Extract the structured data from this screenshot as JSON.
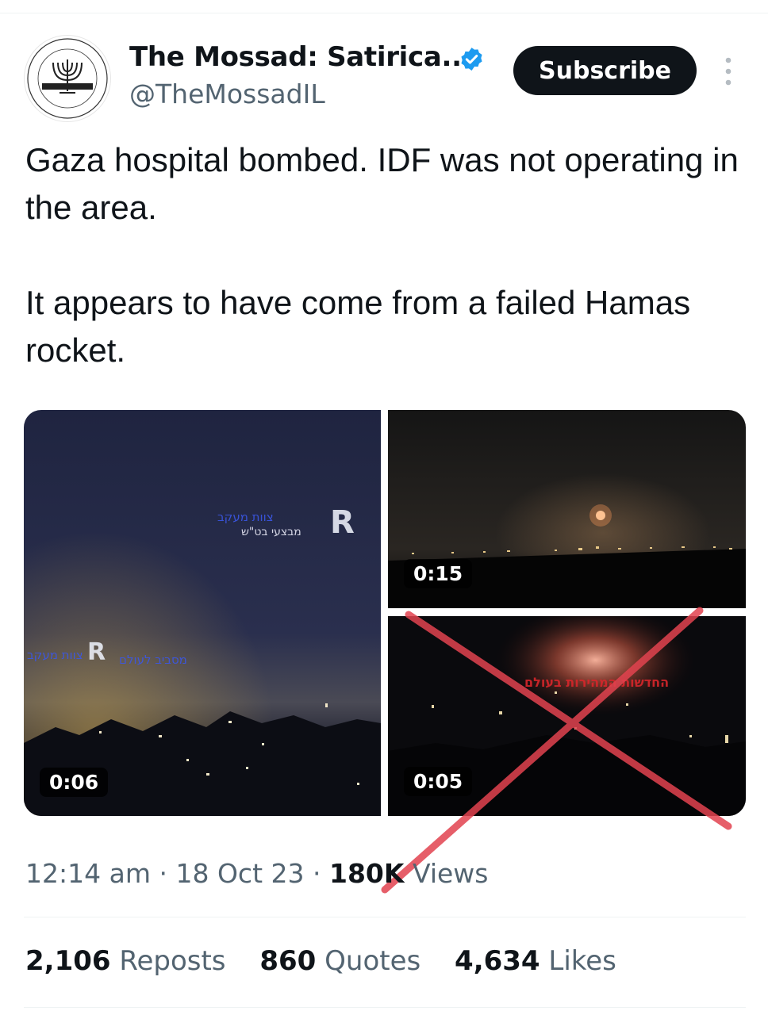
{
  "author": {
    "display_name": "The Mossad: Satirica...",
    "handle": "@TheMossadIL",
    "verified": true,
    "subscribe_label": "Subscribe",
    "avatar_logo_text": "Where there is no intelligence, a nation is doomed",
    "avatar_logo_icon": "menorah-icon"
  },
  "tweet": {
    "paragraphs": [
      "Gaza hospital bombed. IDF was not operating in the area.",
      "It appears to have come from a failed Hamas rocket."
    ]
  },
  "media": {
    "videos": [
      {
        "duration": "0:06",
        "watermarks": [
          "צוות מעקב",
          "מבצעי בט\"ש",
          "R",
          "מסביב לעולם"
        ]
      },
      {
        "duration": "0:15"
      },
      {
        "duration": "0:05",
        "watermark": "החדשות המהירות בעולם",
        "crossed_out": true
      }
    ]
  },
  "meta": {
    "time": "12:14 am",
    "date": "18 Oct 23",
    "views_count": "180K",
    "views_label": "Views",
    "separator": "·"
  },
  "stats": {
    "reposts": {
      "count": "2,106",
      "label": "Reposts"
    },
    "quotes": {
      "count": "860",
      "label": "Quotes"
    },
    "likes": {
      "count": "4,634",
      "label": "Likes"
    }
  },
  "colors": {
    "text_primary": "#0f1419",
    "text_secondary": "#536471",
    "verified_blue": "#1d9bf0",
    "subscribe_bg": "#0f1419",
    "x_overlay": "#e2434f"
  }
}
